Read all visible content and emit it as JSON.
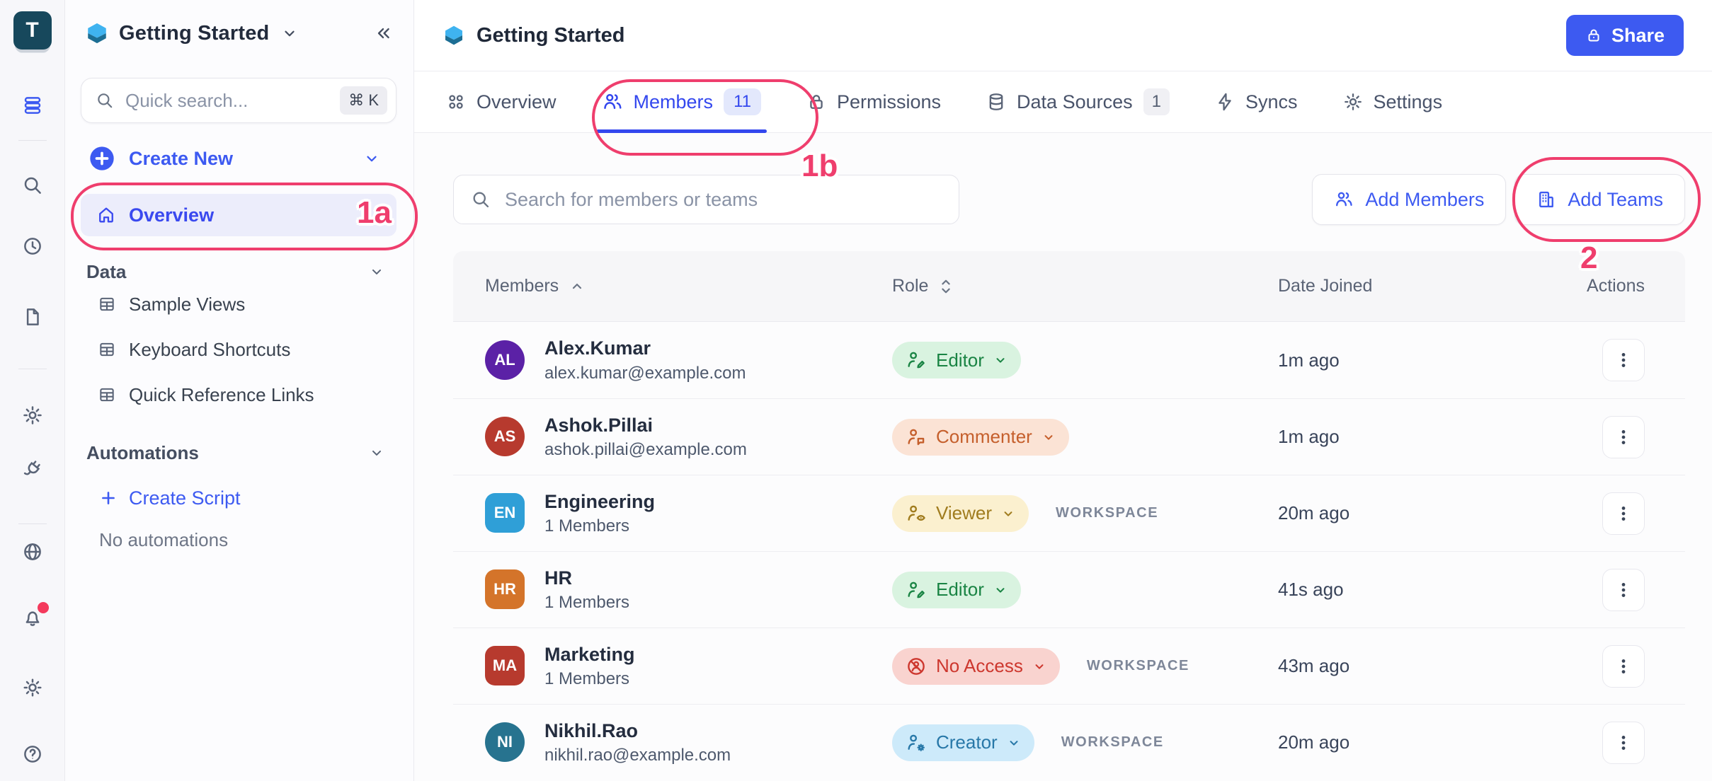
{
  "colors": {
    "accent": "#3d5af1",
    "active_tab": "#3347ee",
    "annotation": "#ef3e6d",
    "rail_logo_bg": "#17485c",
    "role_colors": {
      "editor": {
        "bg": "#d9f3e0",
        "fg": "#1a8444"
      },
      "commenter": {
        "bg": "#fbe3d5",
        "fg": "#c55f2c"
      },
      "viewer": {
        "bg": "#fbf0cf",
        "fg": "#a07c1e"
      },
      "noaccess": {
        "bg": "#f9d3cf",
        "fg": "#cd372e"
      },
      "creator": {
        "bg": "#cdeafa",
        "fg": "#2878a8"
      }
    }
  },
  "rail": {
    "logo_letter": "T",
    "icon_names": [
      "layers-icon",
      "search-icon",
      "clock-icon",
      "document-icon",
      "gear-icon",
      "plug-icon",
      "globe-icon",
      "bell-icon",
      "sun-icon",
      "help-icon"
    ]
  },
  "sidebar": {
    "title": "Getting Started",
    "search": {
      "placeholder": "Quick search...",
      "shortcut": "⌘ K"
    },
    "create_new": "Create New",
    "overview": "Overview",
    "data_section": "Data",
    "data_items": [
      "Sample Views",
      "Keyboard Shortcuts",
      "Quick Reference Links"
    ],
    "automations_section": "Automations",
    "create_script": "Create Script",
    "empty_automations": "No automations"
  },
  "header": {
    "title": "Getting Started",
    "share": "Share"
  },
  "tabs": {
    "overview": "Overview",
    "members": "Members",
    "members_count": "11",
    "permissions": "Permissions",
    "data_sources": "Data Sources",
    "data_sources_count": "1",
    "syncs": "Syncs",
    "settings": "Settings"
  },
  "toolbar": {
    "search_placeholder": "Search for members or teams",
    "add_members": "Add Members",
    "add_teams": "Add Teams"
  },
  "table": {
    "col_members": "Members",
    "col_role": "Role",
    "col_date": "Date Joined",
    "col_actions": "Actions",
    "rows": [
      {
        "initials": "AL",
        "avatar_color": "#5b21a6",
        "avatar_shape": "circle",
        "name": "Alex.Kumar",
        "subtitle": "alex.kumar@example.com",
        "role": "Editor",
        "role_type": "editor",
        "scope": "",
        "date": "1m ago"
      },
      {
        "initials": "AS",
        "avatar_color": "#b73a2e",
        "avatar_shape": "circle",
        "name": "Ashok.Pillai",
        "subtitle": "ashok.pillai@example.com",
        "role": "Commenter",
        "role_type": "commenter",
        "scope": "",
        "date": "1m ago"
      },
      {
        "initials": "EN",
        "avatar_color": "#2f9fd7",
        "avatar_shape": "square",
        "name": "Engineering",
        "subtitle": "1 Members",
        "role": "Viewer",
        "role_type": "viewer",
        "scope": "WORKSPACE",
        "date": "20m ago"
      },
      {
        "initials": "HR",
        "avatar_color": "#d4742a",
        "avatar_shape": "square",
        "name": "HR",
        "subtitle": "1 Members",
        "role": "Editor",
        "role_type": "editor",
        "scope": "",
        "date": "41s ago"
      },
      {
        "initials": "MA",
        "avatar_color": "#b73a2e",
        "avatar_shape": "square",
        "name": "Marketing",
        "subtitle": "1 Members",
        "role": "No Access",
        "role_type": "noaccess",
        "scope": "WORKSPACE",
        "date": "43m ago"
      },
      {
        "initials": "NI",
        "avatar_color": "#27738f",
        "avatar_shape": "circle",
        "name": "Nikhil.Rao",
        "subtitle": "nikhil.rao@example.com",
        "role": "Creator",
        "role_type": "creator",
        "scope": "WORKSPACE",
        "date": "20m ago"
      }
    ]
  },
  "annotations": {
    "a1": "1a",
    "b1": "1b",
    "n2": "2"
  }
}
